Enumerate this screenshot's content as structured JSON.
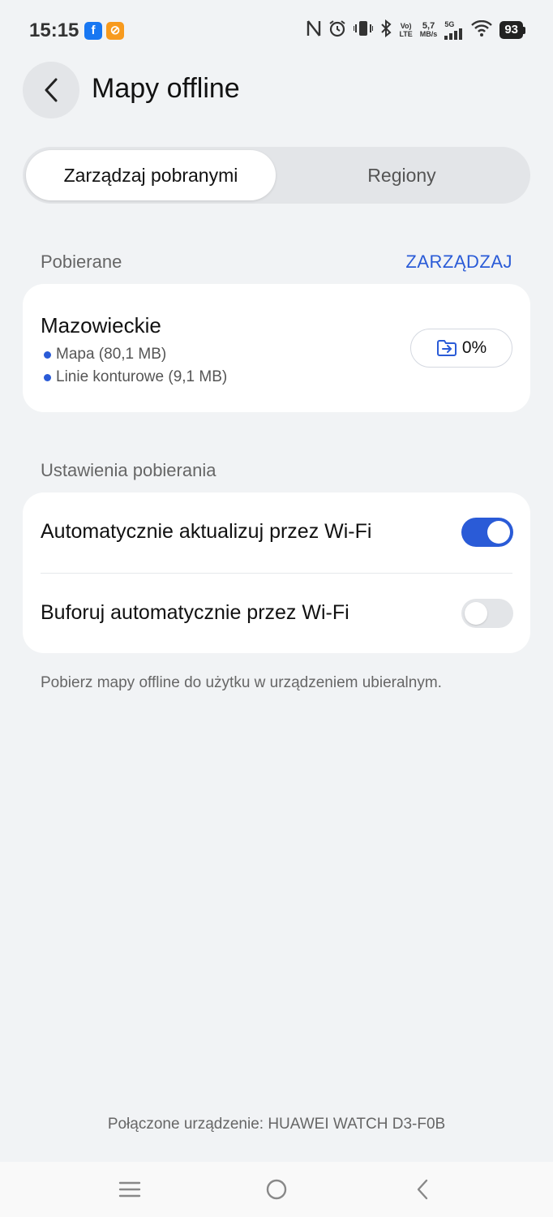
{
  "status_bar": {
    "time": "15:15",
    "app_badges": [
      "f",
      "⊘"
    ],
    "network_volte": "Vo)",
    "network_lte": "LTE",
    "speed_value": "5,7",
    "speed_unit": "MB/s",
    "signal_label": "5G",
    "battery": "93",
    "icons": [
      "nfc-icon",
      "alarm-icon",
      "vibrate-icon",
      "bluetooth-icon",
      "volte-icon",
      "signal-icon",
      "wifi-icon",
      "battery-icon"
    ]
  },
  "header": {
    "title": "Mapy offline"
  },
  "tabs": [
    {
      "label": "Zarządzaj pobranymi",
      "active": true
    },
    {
      "label": "Regiony",
      "active": false
    }
  ],
  "downloads": {
    "section_label": "Pobierane",
    "manage_label": "ZARZĄDZAJ",
    "region": "Mazowieckie",
    "items": [
      {
        "label": "Mapa (80,1 MB)"
      },
      {
        "label": "Linie konturowe (9,1 MB)"
      }
    ],
    "progress_label": "0%"
  },
  "settings": {
    "section_label": "Ustawienia pobierania",
    "rows": [
      {
        "label": "Automatycznie aktualizuj przez Wi-Fi",
        "enabled": true
      },
      {
        "label": "Buforuj automatycznie przez Wi-Fi",
        "enabled": false
      }
    ],
    "footnote": "Pobierz mapy offline do użytku w urządzeniem ubieralnym."
  },
  "connected_device": "Połączone urządzenie: HUAWEI WATCH D3-F0B",
  "colors": {
    "accent": "#2A5BD7",
    "background": "#F1F3F5",
    "card": "#FFFFFF"
  }
}
